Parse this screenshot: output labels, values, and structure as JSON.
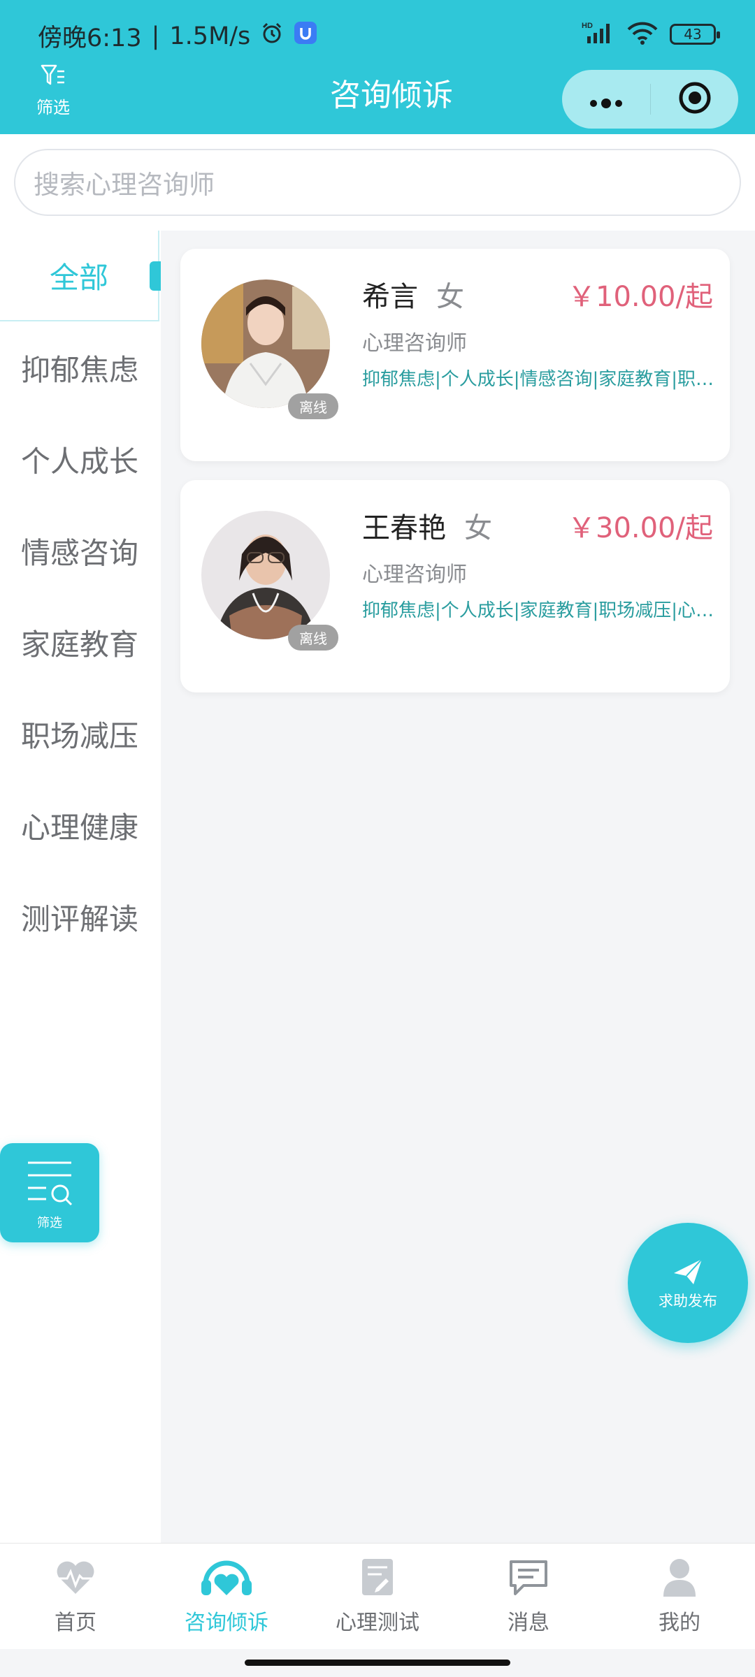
{
  "status_bar": {
    "time": "傍晚6:13",
    "speed": "1.5M/s",
    "network": "HD",
    "battery": "43"
  },
  "header": {
    "filter_label": "筛选",
    "title": "咨询倾诉"
  },
  "search": {
    "placeholder": "搜索心理咨询师"
  },
  "sidebar": {
    "items": [
      {
        "label": "全部",
        "active": true
      },
      {
        "label": "抑郁焦虑"
      },
      {
        "label": "个人成长"
      },
      {
        "label": "情感咨询"
      },
      {
        "label": "家庭教育"
      },
      {
        "label": "职场减压"
      },
      {
        "label": "心理健康"
      },
      {
        "label": "测评解读"
      }
    ]
  },
  "counselors": [
    {
      "name": "希言",
      "gender": "女",
      "price": "￥10.00/起",
      "role": "心理咨询师",
      "tags": "抑郁焦虑|个人成长|情感咨询|家庭教育|职场减压|心理健康",
      "status": "离线"
    },
    {
      "name": "王春艳",
      "gender": "女",
      "price": "￥30.00/起",
      "role": "心理咨询师",
      "tags": "抑郁焦虑|个人成长|家庭教育|职场减压|心理健康|测评解读",
      "status": "离线"
    }
  ],
  "float_filter": {
    "label": "筛选"
  },
  "help_button": {
    "label": "求助发布"
  },
  "tabbar": {
    "items": [
      {
        "label": "首页",
        "icon": "heartbeat-icon"
      },
      {
        "label": "咨询倾诉",
        "icon": "headphones-heart-icon",
        "active": true
      },
      {
        "label": "心理测试",
        "icon": "document-edit-icon"
      },
      {
        "label": "消息",
        "icon": "chat-icon"
      },
      {
        "label": "我的",
        "icon": "user-icon"
      }
    ]
  },
  "colors": {
    "primary": "#2fc7d8",
    "price": "#e0617a",
    "tag": "#2a9d9f"
  }
}
